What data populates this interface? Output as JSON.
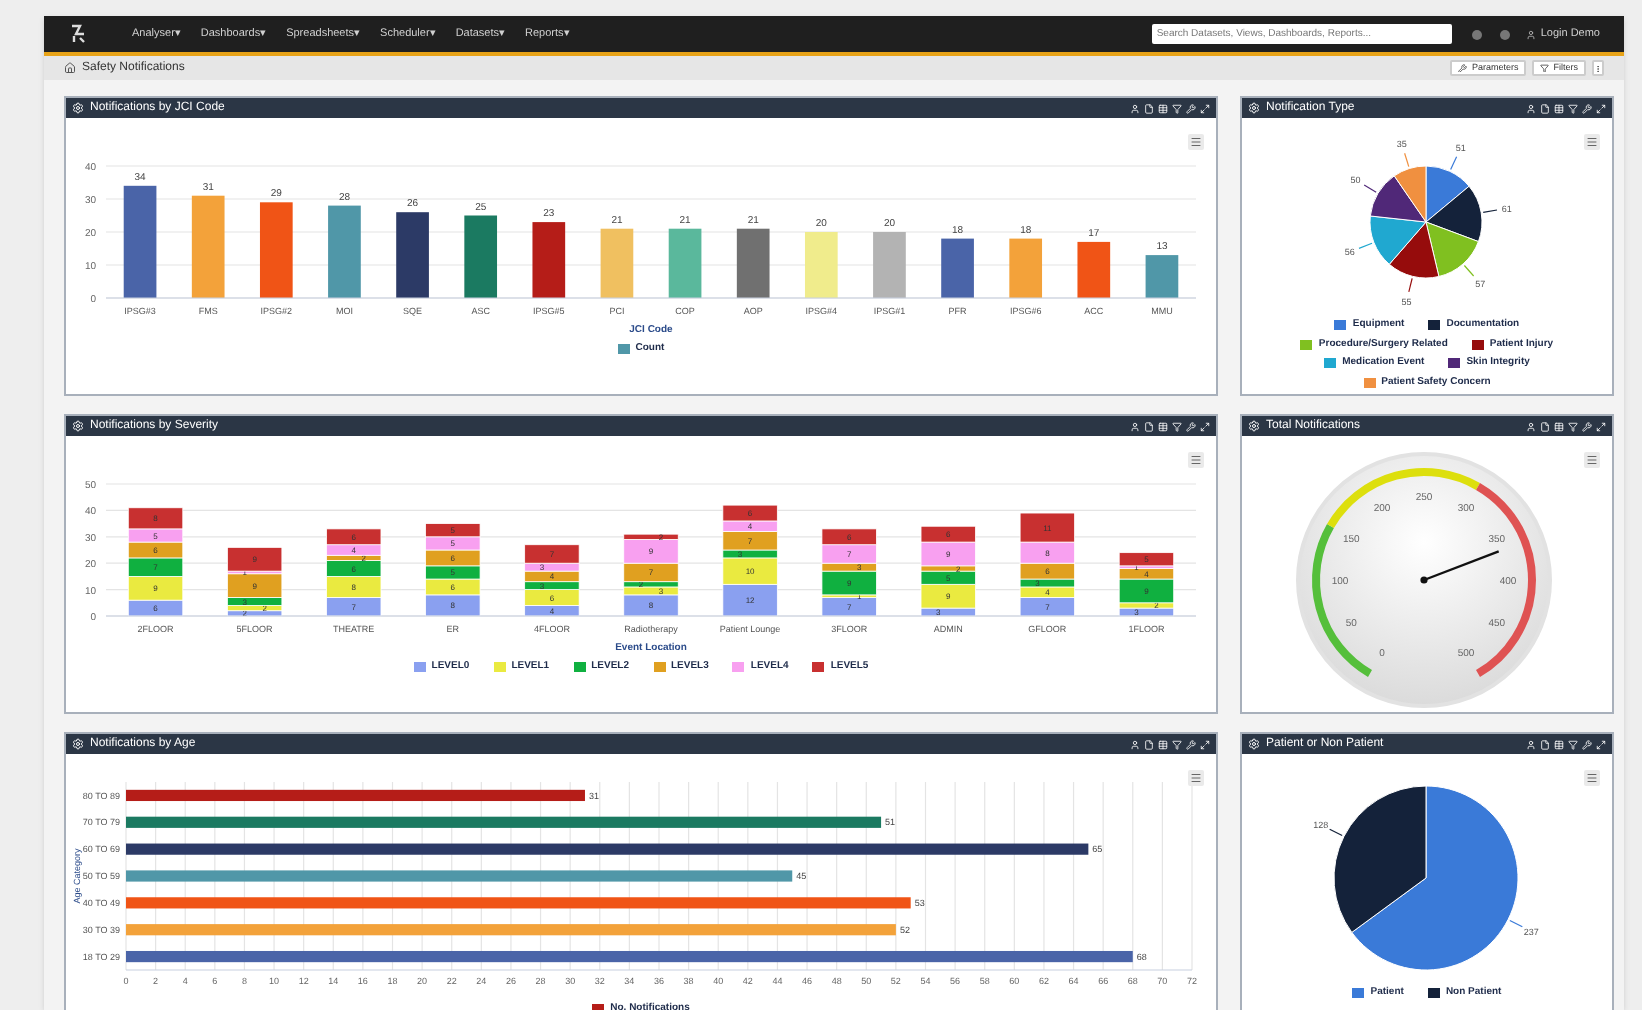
{
  "nav": {
    "items": [
      "Analyser▾",
      "Dashboards▾",
      "Spreadsheets▾",
      "Scheduler▾",
      "Datasets▾",
      "Reports▾"
    ],
    "search": {
      "placeholder": "Search Datasets, Views, Dashboards, Reports..."
    },
    "user": "Login Demo"
  },
  "page": {
    "title": "Safety Notifications",
    "buttons": [
      {
        "label": "Parameters",
        "kind": "parameters"
      },
      {
        "label": "Filters",
        "kind": "filters"
      }
    ]
  },
  "panels": [
    {
      "kind": "chart",
      "title": "Notifications by JCI Code",
      "legend_swatch": {
        "color": "#5097a8"
      },
      "chart_data": {
        "type": "bar",
        "xlabel": "JCI Code",
        "categories": [
          "IPSG#3",
          "FMS",
          "IPSG#2",
          "MOI",
          "SQE",
          "ASC",
          "IPSG#5",
          "PCI",
          "COP",
          "AOP",
          "IPSG#4",
          "IPSG#1",
          "PFR",
          "IPSG#6",
          "ACC",
          "MMU"
        ],
        "series": [
          {
            "name": "Count",
            "values": [
              34,
              31,
              29,
              28,
              26,
              25,
              23,
              21,
              21,
              21,
              20,
              20,
              18,
              18,
              17,
              13
            ]
          }
        ],
        "colors": [
          "#4a64a8",
          "#f3a23a",
          "#f05416",
          "#5097a8",
          "#2c3a66",
          "#1b7a61",
          "#b51d18",
          "#f0c060",
          "#5ab89c",
          "#707070",
          "#f0ec8c",
          "#b3b3b3",
          "#4a64a8",
          "#f3a23a",
          "#f05416",
          "#5097a8"
        ],
        "ylim": [
          0,
          40
        ],
        "yticks": [
          0,
          10,
          20,
          30,
          40
        ],
        "grid": true,
        "legend": "bottom",
        "data_labels": true
      }
    },
    {
      "kind": "chart",
      "title": "Notification Type",
      "chart_data": {
        "type": "pie",
        "categories": [
          "Equipment",
          "Documentation",
          "Procedure/Surgery Related",
          "Patient Injury",
          "Medication Event",
          "Skin Integrity",
          "Patient Safety Concern"
        ],
        "values": [
          51,
          61,
          57,
          55,
          56,
          50,
          35
        ],
        "colors": [
          "#3a7ad8",
          "#14223a",
          "#80c020",
          "#960c0c",
          "#20a8d0",
          "#502878",
          "#f09040"
        ],
        "legend": "bottom",
        "data_labels": true
      }
    },
    {
      "kind": "chart",
      "title": "Notifications by Severity",
      "chart_data": {
        "type": "bar",
        "stacked": true,
        "xlabel": "Event Location",
        "categories": [
          "2FLOOR",
          "5FLOOR",
          "THEATRE",
          "ER",
          "4FLOOR",
          "Radiotherapy",
          "Patient Lounge",
          "3FLOOR",
          "ADMIN",
          "GFLOOR",
          "1FLOOR"
        ],
        "series": [
          {
            "name": "LEVEL0",
            "color": "#8aa0f0",
            "values": [
              6,
              2,
              7,
              8,
              4,
              8,
              12,
              7,
              3,
              7,
              3
            ]
          },
          {
            "name": "LEVEL1",
            "color": "#eaea40",
            "values": [
              9,
              2,
              8,
              6,
              6,
              3,
              10,
              1,
              9,
              4,
              2
            ]
          },
          {
            "name": "LEVEL2",
            "color": "#10b040",
            "values": [
              7,
              3,
              6,
              5,
              3,
              2,
              3,
              9,
              5,
              3,
              9
            ]
          },
          {
            "name": "LEVEL3",
            "color": "#e0a020",
            "values": [
              6,
              9,
              2,
              6,
              4,
              7,
              7,
              3,
              2,
              6,
              4
            ]
          },
          {
            "name": "LEVEL4",
            "color": "#f8a0f0",
            "values": [
              5,
              1,
              4,
              5,
              3,
              9,
              4,
              7,
              9,
              8,
              1
            ]
          },
          {
            "name": "LEVEL5",
            "color": "#c83030",
            "values": [
              8,
              9,
              6,
              5,
              7,
              2,
              6,
              6,
              6,
              11,
              5
            ]
          }
        ],
        "ylim": [
          0,
          50
        ],
        "yticks": [
          0,
          10,
          20,
          30,
          40,
          50
        ],
        "grid": true,
        "legend": "bottom",
        "data_labels": true
      }
    },
    {
      "kind": "gauge",
      "title": "Total Notifications",
      "ticks": [
        "0",
        "50",
        "100",
        "150",
        "200",
        "250",
        "300",
        "350",
        "400",
        "450",
        "500"
      ]
    },
    {
      "kind": "chart",
      "title": "Notifications by Age",
      "legend_swatch": {
        "color": "#b51d18"
      },
      "chart_data": {
        "type": "bar",
        "orientation": "horizontal",
        "ylabel": "Age Category",
        "categories": [
          "80 TO 89",
          "70 TO 79",
          "60 TO 69",
          "50 TO 59",
          "40 TO 49",
          "30 TO 39",
          "18 TO 29"
        ],
        "series": [
          {
            "name": "No. Notifications",
            "values": [
              31,
              51,
              65,
              45,
              53,
              52,
              68
            ]
          }
        ],
        "colors": [
          "#b51d18",
          "#1b7a61",
          "#2c3a66",
          "#5097a8",
          "#f05416",
          "#f3a23a",
          "#4a64a8"
        ],
        "xlim": [
          0,
          72
        ],
        "xticks": [
          0,
          2,
          4,
          6,
          8,
          10,
          12,
          14,
          16,
          18,
          20,
          22,
          24,
          26,
          28,
          30,
          32,
          34,
          36,
          38,
          40,
          42,
          44,
          46,
          48,
          50,
          52,
          54,
          56,
          58,
          60,
          62,
          64,
          66,
          68,
          70,
          72
        ],
        "grid": true,
        "legend": "bottom",
        "data_labels": true
      }
    },
    {
      "kind": "chart",
      "title": "Patient or Non Patient",
      "chart_data": {
        "type": "pie",
        "categories": [
          "Patient",
          "Non Patient"
        ],
        "values": [
          237,
          128
        ],
        "colors": [
          "#3a7ad8",
          "#14223a"
        ],
        "legend": "bottom",
        "data_labels": true
      }
    }
  ]
}
